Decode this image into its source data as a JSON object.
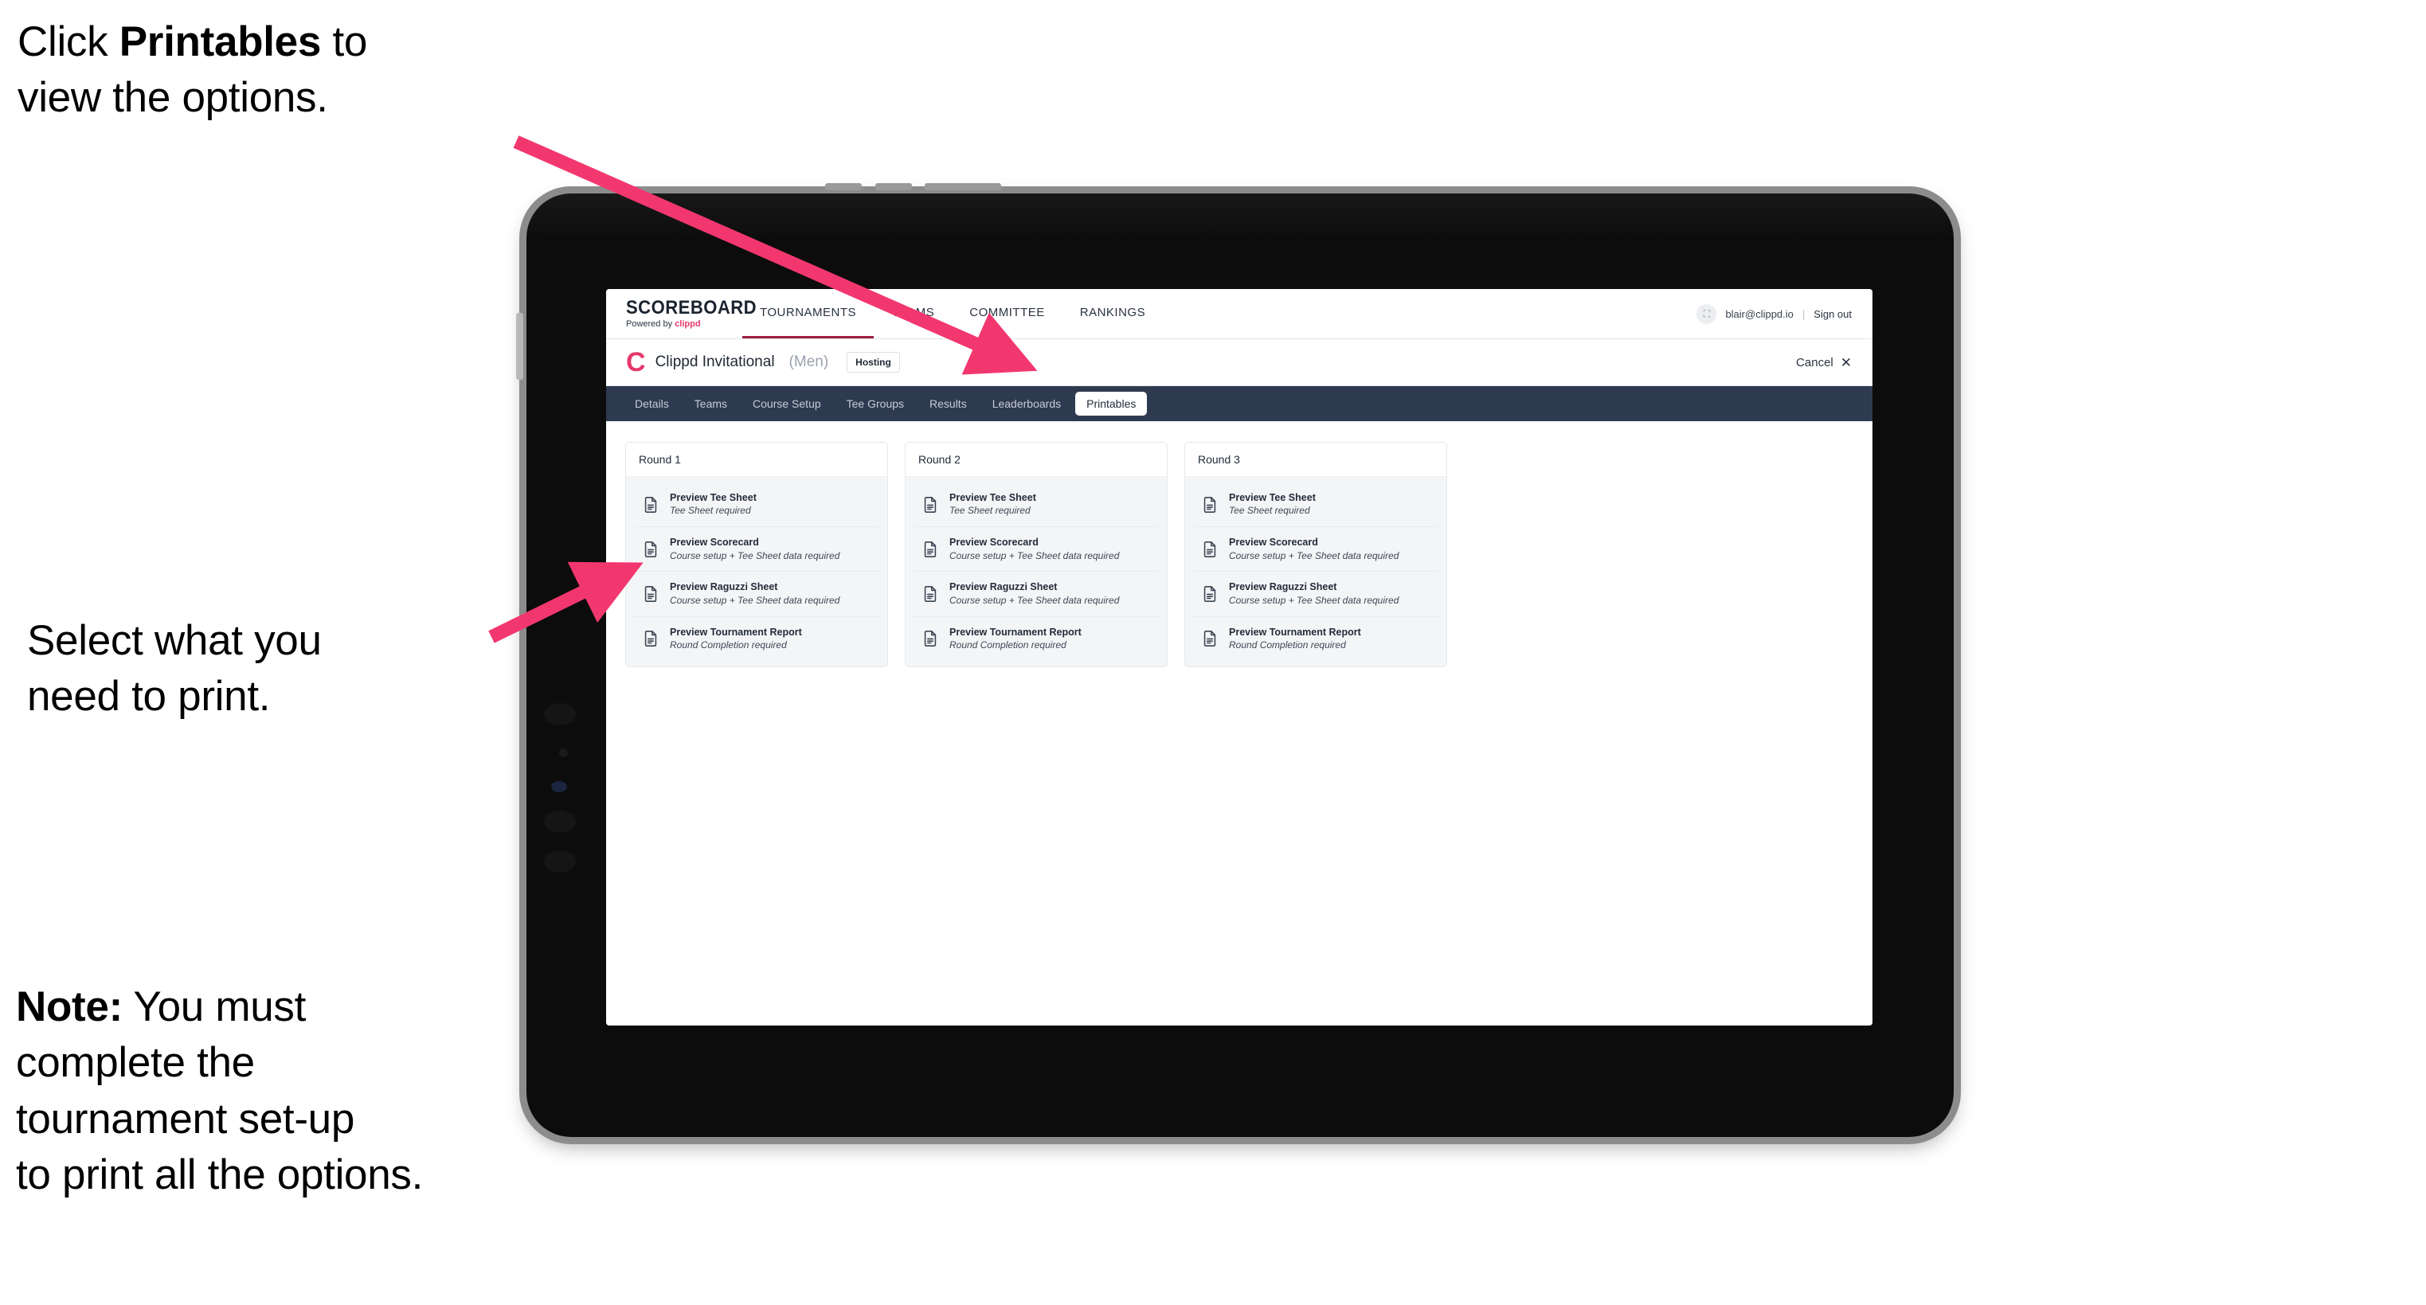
{
  "annotations": {
    "callout_1": "Click **Printables** to\nview the options.",
    "callout_1_plain_pre": "Click ",
    "callout_1_bold": "Printables",
    "callout_1_post": " to\nview the options.",
    "callout_2": "Select what you\n need to print.",
    "callout_3_bold": "Note:",
    "callout_3_post": " You must\ncomplete the\ntournament set-up\nto print all the options.",
    "arrow_color": "#f2376f"
  },
  "app": {
    "brand": {
      "wordmark": "SCOREBOARD",
      "powered_by_prefix": "Powered by ",
      "powered_by_name": "clippd"
    },
    "top_nav": [
      {
        "label": "TOURNAMENTS",
        "active": true
      },
      {
        "label": "TEAMS",
        "active": false
      },
      {
        "label": "COMMITTEE",
        "active": false
      },
      {
        "label": "RANKINGS",
        "active": false
      }
    ],
    "account": {
      "avatar_glyph": "⛶",
      "email": "blair@clippd.io",
      "separator": "|",
      "sign_out": "Sign out"
    },
    "tournament_bar": {
      "logo_letter": "C",
      "name": "Clippd Invitational",
      "gender": "(Men)",
      "status_badge": "Hosting",
      "cancel_label": "Cancel",
      "cancel_icon": "✕"
    },
    "section_nav": [
      {
        "label": "Details",
        "active": false
      },
      {
        "label": "Teams",
        "active": false
      },
      {
        "label": "Course Setup",
        "active": false
      },
      {
        "label": "Tee Groups",
        "active": false
      },
      {
        "label": "Results",
        "active": false
      },
      {
        "label": "Leaderboards",
        "active": false
      },
      {
        "label": "Printables",
        "active": true
      }
    ],
    "rounds": [
      {
        "title": "Round 1",
        "items": [
          {
            "title": "Preview Tee Sheet",
            "subtitle": "Tee Sheet required"
          },
          {
            "title": "Preview Scorecard",
            "subtitle": "Course setup + Tee Sheet data required"
          },
          {
            "title": "Preview Raguzzi Sheet",
            "subtitle": "Course setup + Tee Sheet data required"
          },
          {
            "title": "Preview Tournament Report",
            "subtitle": "Round Completion required"
          }
        ]
      },
      {
        "title": "Round 2",
        "items": [
          {
            "title": "Preview Tee Sheet",
            "subtitle": "Tee Sheet required"
          },
          {
            "title": "Preview Scorecard",
            "subtitle": "Course setup + Tee Sheet data required"
          },
          {
            "title": "Preview Raguzzi Sheet",
            "subtitle": "Course setup + Tee Sheet data required"
          },
          {
            "title": "Preview Tournament Report",
            "subtitle": "Round Completion required"
          }
        ]
      },
      {
        "title": "Round 3",
        "items": [
          {
            "title": "Preview Tee Sheet",
            "subtitle": "Tee Sheet required"
          },
          {
            "title": "Preview Scorecard",
            "subtitle": "Course setup + Tee Sheet data required"
          },
          {
            "title": "Preview Raguzzi Sheet",
            "subtitle": "Course setup + Tee Sheet data required"
          },
          {
            "title": "Preview Tournament Report",
            "subtitle": "Round Completion required"
          }
        ]
      }
    ]
  },
  "colors": {
    "accent_pink": "#e5396c",
    "nav_dark": "#2e3a4f",
    "active_underline": "#9c1f40",
    "annotation_arrow": "#f2376f",
    "card_bg": "#f4f5f7"
  }
}
